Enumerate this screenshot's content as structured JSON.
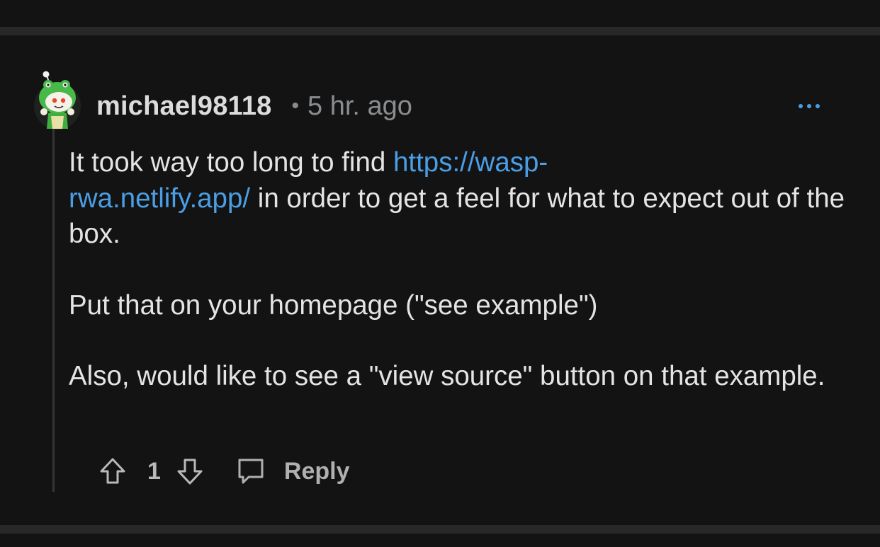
{
  "comment": {
    "author": "michael98118",
    "separator": "•",
    "timestamp": "5 hr. ago",
    "more_label": "...",
    "body": {
      "p1_text": "It took way too long to find ",
      "p1_link": "https://wasp-rwa.netlify.app/",
      "p1_link_display_line1": "https://wasp-",
      "p1_link_display_line2": "rwa.netlify.app/",
      "p1_rest": " in order to get a feel for what to expect out of the box.",
      "p2": "Put that on your homepage (\"see example\")",
      "p3": "Also, would like to see a \"view source\" button on that example."
    },
    "votes": "1",
    "reply_label": "Reply"
  },
  "icons": {
    "avatar": "snoo-avatar-frog-hood",
    "more": "ellipsis-icon",
    "upvote": "arrow-up-icon",
    "downvote": "arrow-down-icon",
    "reply": "speech-bubble-icon"
  },
  "colors": {
    "background": "#131313",
    "divider": "#272829",
    "link": "#4a9ee6",
    "muted": "#8a8d90",
    "text": "#e4e4e4",
    "more_icon": "#4a9ee6"
  }
}
